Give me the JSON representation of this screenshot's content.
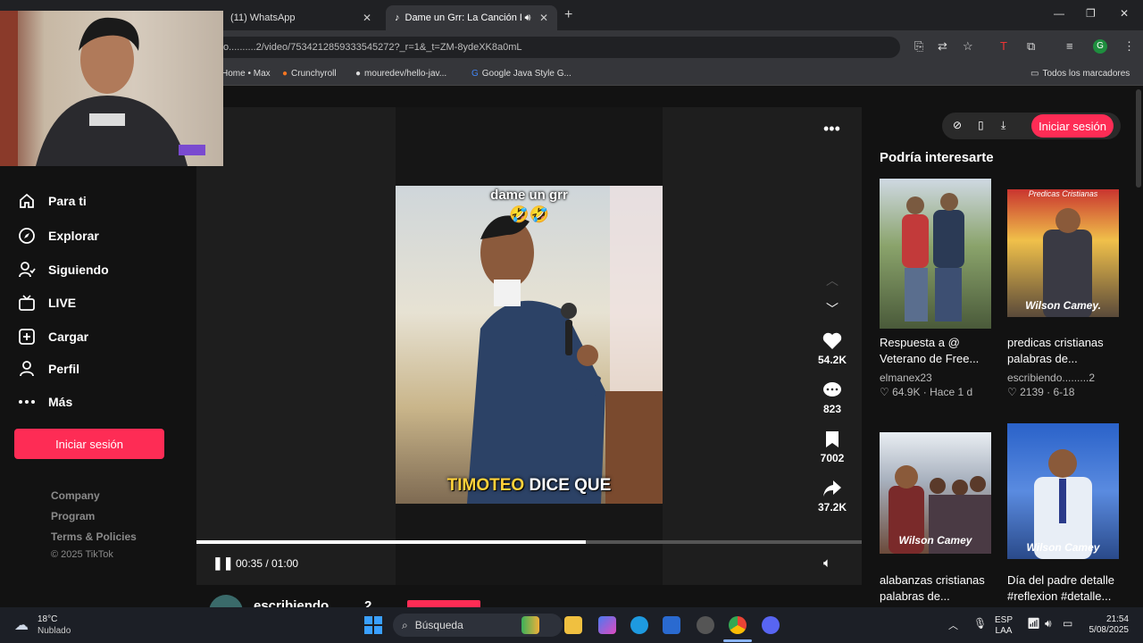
{
  "browser": {
    "tabs": [
      {
        "title": "(11) WhatsApp"
      },
      {
        "title": "Dame un Grr: La Canción D"
      }
    ],
    "url": "o..........2/video/7534212859333545272?_r=1&_t=ZM-8ydeXK8a0mL",
    "bookmarks": [
      "Home • Max",
      "Crunchyroll",
      "mouredev/hello-jav...",
      "Google Java Style G..."
    ],
    "all_bookmarks": "Todos los marcadores",
    "avatar_letter": "G"
  },
  "sidebar": {
    "items": [
      {
        "label": "Para ti",
        "icon": "home-icon"
      },
      {
        "label": "Explorar",
        "icon": "compass-icon"
      },
      {
        "label": "Siguiendo",
        "icon": "following-icon"
      },
      {
        "label": "LIVE",
        "icon": "live-icon"
      },
      {
        "label": "Cargar",
        "icon": "upload-icon"
      },
      {
        "label": "Perfil",
        "icon": "profile-icon"
      },
      {
        "label": "Más",
        "icon": "more-icon"
      }
    ],
    "login": "Iniciar sesión",
    "footer": [
      "Company",
      "Program",
      "Terms & Policies"
    ],
    "copyright": "© 2025 TikTok"
  },
  "video": {
    "caption_top": "dame un grr",
    "caption_emoji": "🤣🤣",
    "caption_bottom_a": "TIMOTEO",
    "caption_bottom_b": "DICE QUE",
    "likes": "54.2K",
    "comments": "823",
    "saves": "7002",
    "shares": "37.2K",
    "time": "00:35 / 01:00",
    "progress": 0.585,
    "author": "escribiendo",
    "author_suffix": "2"
  },
  "right": {
    "login": "Iniciar sesión",
    "title": "Podría interesarte",
    "cards": [
      {
        "title": "Respuesta a @ Veterano de Free...",
        "user": "elmanex23",
        "meta": "♡ 64.9K · Hace 1 d",
        "overlay": ""
      },
      {
        "title": "predicas cristianas palabras de...",
        "user": "escribiendo.........2",
        "meta": "♡ 2139 · 6-18",
        "overlay": "Wilson Camey."
      },
      {
        "title": "alabanzas cristianas palabras de...",
        "user": "",
        "meta": "",
        "overlay": "Wilson Camey"
      },
      {
        "title": "Día del padre detalle #reflexion #detalle...",
        "user": "",
        "meta": "",
        "overlay": "Wilson Camey"
      }
    ],
    "thumb_top_text": "Predicas Cristianas"
  },
  "taskbar": {
    "weather_temp": "18°C",
    "weather_desc": "Nublado",
    "search": "Búsqueda",
    "lang_a": "ESP",
    "lang_b": "LAA",
    "time": "21:54",
    "date": "5/08/2025"
  }
}
